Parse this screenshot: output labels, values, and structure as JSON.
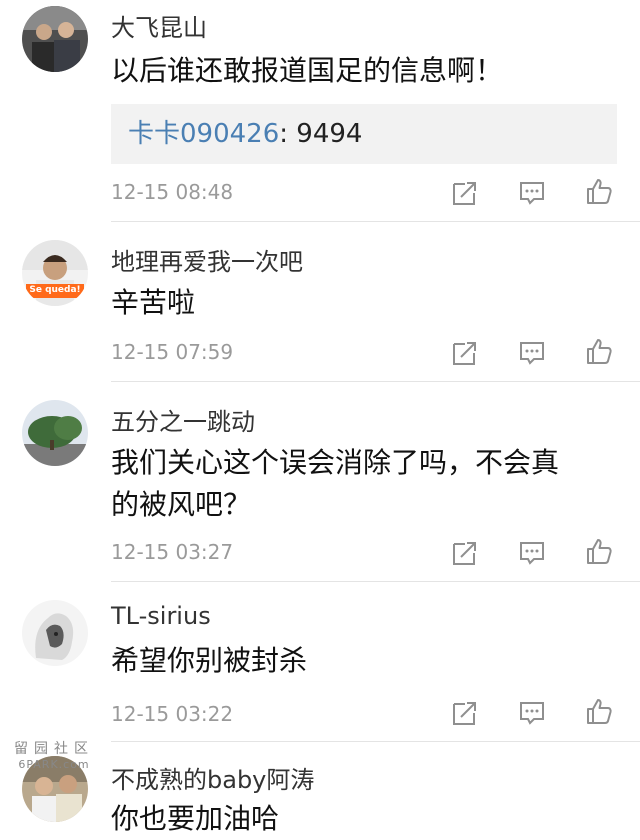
{
  "comments": [
    {
      "username": "大飞昆山",
      "content": "以后谁还敢报道国足的信息啊！",
      "quote": {
        "user": "卡卡090426",
        "text": ": 9494"
      },
      "timestamp": "12-15 08:48"
    },
    {
      "username": "地理再爱我一次吧",
      "content": "辛苦啦",
      "avatar_text": "Se queda!",
      "timestamp": "12-15 07:59"
    },
    {
      "username": "五分之一跳动",
      "content_line1": "我们关心这个误会消除了吗，不会真",
      "content_line2": "的被风吧？",
      "timestamp": "12-15 03:27"
    },
    {
      "username": "TL-sirius",
      "content": "希望你别被封杀",
      "timestamp": "12-15 03:22"
    },
    {
      "username": "不成熟的baby阿涛",
      "content": "你也要加油哈"
    }
  ],
  "watermark": {
    "top": "留园社区",
    "bottom": "6PARK.com"
  },
  "icons": {
    "share": "share-icon",
    "comment": "comment-icon",
    "like": "like-icon"
  },
  "colors": {
    "quote_user": "#4a7fb3",
    "timestamp": "#9a9a9a",
    "icon": "#8f8f8f"
  }
}
